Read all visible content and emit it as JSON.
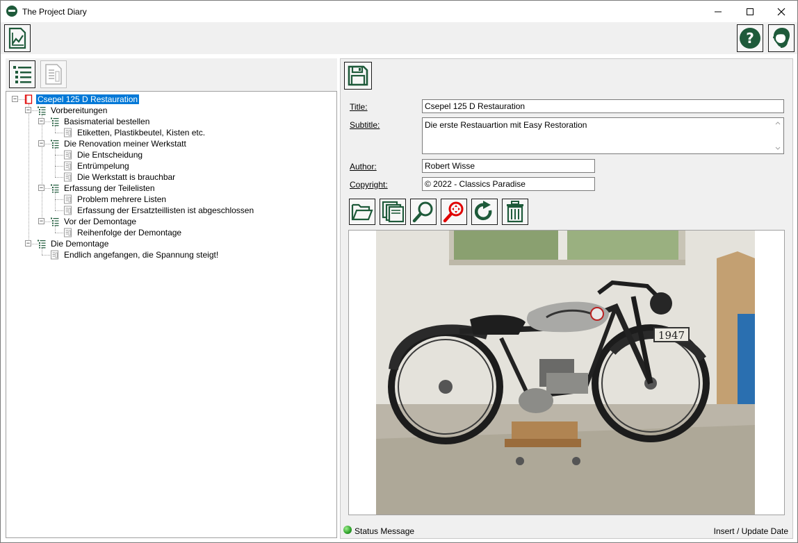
{
  "window": {
    "title": "The Project Diary",
    "controls": {
      "minimize": "—",
      "maximize": "☐",
      "close": "✕"
    }
  },
  "colors": {
    "accent": "#1e5a3a",
    "selection": "#0078d7",
    "icon_red": "#e00000"
  },
  "toolbar": {
    "left_button_icon": "chart-line-icon",
    "help_button_icon": "help-icon",
    "support_button_icon": "support-headset-icon"
  },
  "tree_toolbar": {
    "tree_view_icon": "list-tree-icon",
    "document_view_icon": "document-icon"
  },
  "tree": {
    "nodes": [
      {
        "label": "Csepel 125 D Restauration",
        "icon": "book-icon",
        "selected": true
      },
      {
        "label": "Vorbereitungen",
        "icon": "chapter-list-icon"
      },
      {
        "label": "Basismaterial bestellen",
        "icon": "chapter-list-icon"
      },
      {
        "label": "Etiketten, Plastikbeutel, Kisten etc.",
        "icon": "page-icon"
      },
      {
        "label": "Die Renovation meiner Werkstatt",
        "icon": "chapter-list-icon"
      },
      {
        "label": "Die Entscheidung",
        "icon": "page-icon"
      },
      {
        "label": "Entrümpelung",
        "icon": "page-icon"
      },
      {
        "label": "Die Werkstatt is brauchbar",
        "icon": "page-icon"
      },
      {
        "label": "Erfassung der Teilelisten",
        "icon": "chapter-list-icon"
      },
      {
        "label": "Problem mehrere Listen",
        "icon": "page-icon"
      },
      {
        "label": "Erfassung der Ersatzteillisten ist abgeschlossen",
        "icon": "page-icon"
      },
      {
        "label": "Vor der Demontage",
        "icon": "chapter-list-icon"
      },
      {
        "label": "Reihenfolge der Demontage",
        "icon": "page-icon"
      },
      {
        "label": "Die Demontage",
        "icon": "chapter-list-icon"
      },
      {
        "label": "Endlich angefangen, die Spannung steigt!",
        "icon": "page-icon"
      }
    ]
  },
  "form": {
    "title_label": "Title:",
    "title_value": "Csepel 125 D Restauration",
    "subtitle_label": "Subtitle:",
    "subtitle_value": "Die erste Restauartion mit Easy Restoration",
    "author_label": "Author:",
    "author_value": "Robert Wisse",
    "copyright_label": "Copyright:",
    "copyright_value": "© 2022 - Classics Paradise"
  },
  "image_toolbar": {
    "buttons": [
      "open-folder-icon",
      "copy-pages-icon",
      "zoom-icon",
      "zoom-reset-icon",
      "rotate-icon",
      "delete-icon"
    ]
  },
  "photo": {
    "plate_text": "1947"
  },
  "status": {
    "message": "Status Message",
    "right": "Insert / Update Date"
  }
}
